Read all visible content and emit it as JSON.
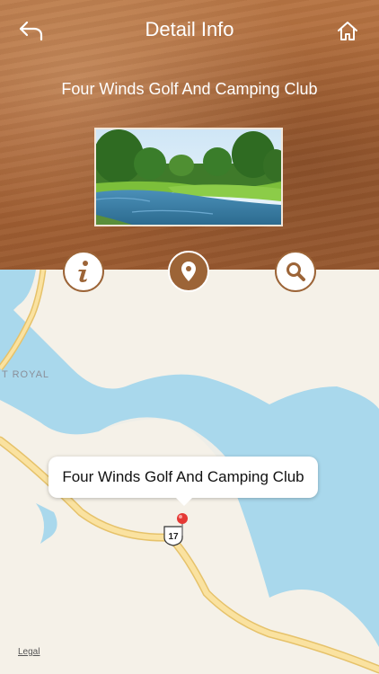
{
  "header": {
    "title": "Detail Info",
    "back_icon": "back-arrow-icon",
    "home_icon": "home-icon"
  },
  "place": {
    "name": "Four Winds Golf And Camping Club"
  },
  "actions": [
    {
      "name": "info",
      "icon": "info-icon"
    },
    {
      "name": "map",
      "icon": "location-pin-icon",
      "active": true
    },
    {
      "name": "search",
      "icon": "search-icon"
    }
  ],
  "map": {
    "callout_label": "Four Winds Golf And Camping Club",
    "area_label": "T ROYAL",
    "route_shield": "17",
    "legal": "Legal"
  },
  "colors": {
    "accent": "#9c6437",
    "water": "#a9d8ec",
    "land": "#f5f1e8",
    "road": "#f6d98a",
    "pin": "#e53935"
  }
}
